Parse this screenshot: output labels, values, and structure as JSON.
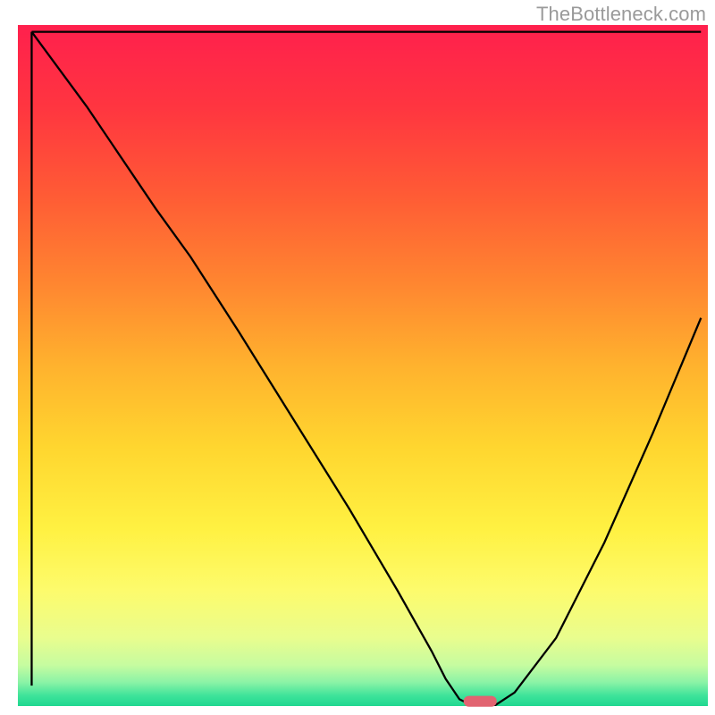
{
  "watermark": "TheBottleneck.com",
  "chart_data": {
    "type": "line",
    "title": "",
    "xlabel": "",
    "ylabel": "",
    "xlim": [
      0,
      100
    ],
    "ylim": [
      0,
      100
    ],
    "grid": false,
    "legend": false,
    "background_gradient_stops": [
      {
        "offset": 0.0,
        "color": "#ff204d"
      },
      {
        "offset": 0.12,
        "color": "#ff3540"
      },
      {
        "offset": 0.25,
        "color": "#ff5b35"
      },
      {
        "offset": 0.38,
        "color": "#ff8630"
      },
      {
        "offset": 0.5,
        "color": "#ffb22e"
      },
      {
        "offset": 0.62,
        "color": "#ffd62f"
      },
      {
        "offset": 0.74,
        "color": "#fff142"
      },
      {
        "offset": 0.83,
        "color": "#fdfb6c"
      },
      {
        "offset": 0.9,
        "color": "#e9fd8e"
      },
      {
        "offset": 0.94,
        "color": "#c6fca0"
      },
      {
        "offset": 0.965,
        "color": "#8bf3a6"
      },
      {
        "offset": 0.985,
        "color": "#3de39a"
      },
      {
        "offset": 1.0,
        "color": "#1fd890"
      }
    ],
    "series": [
      {
        "name": "bottleneck-curve",
        "x": [
          2,
          10,
          20,
          25,
          32,
          40,
          48,
          55,
          60,
          62,
          64,
          66,
          69,
          72,
          78,
          85,
          92,
          99
        ],
        "y": [
          99,
          88,
          73,
          66,
          55,
          42,
          29,
          17,
          8,
          4,
          1,
          0,
          0,
          2,
          10,
          24,
          40,
          57
        ]
      }
    ],
    "marker": {
      "name": "optimal-pill",
      "x": 67,
      "y": 0.7,
      "color": "#e16471",
      "width_pct": 4.8,
      "height_pct": 1.6
    },
    "axes": {
      "left": {
        "x": 2,
        "from_y": 3,
        "to_y": 99
      },
      "bottom": {
        "y": 99,
        "from_x": 2,
        "to_x": 99
      }
    }
  }
}
